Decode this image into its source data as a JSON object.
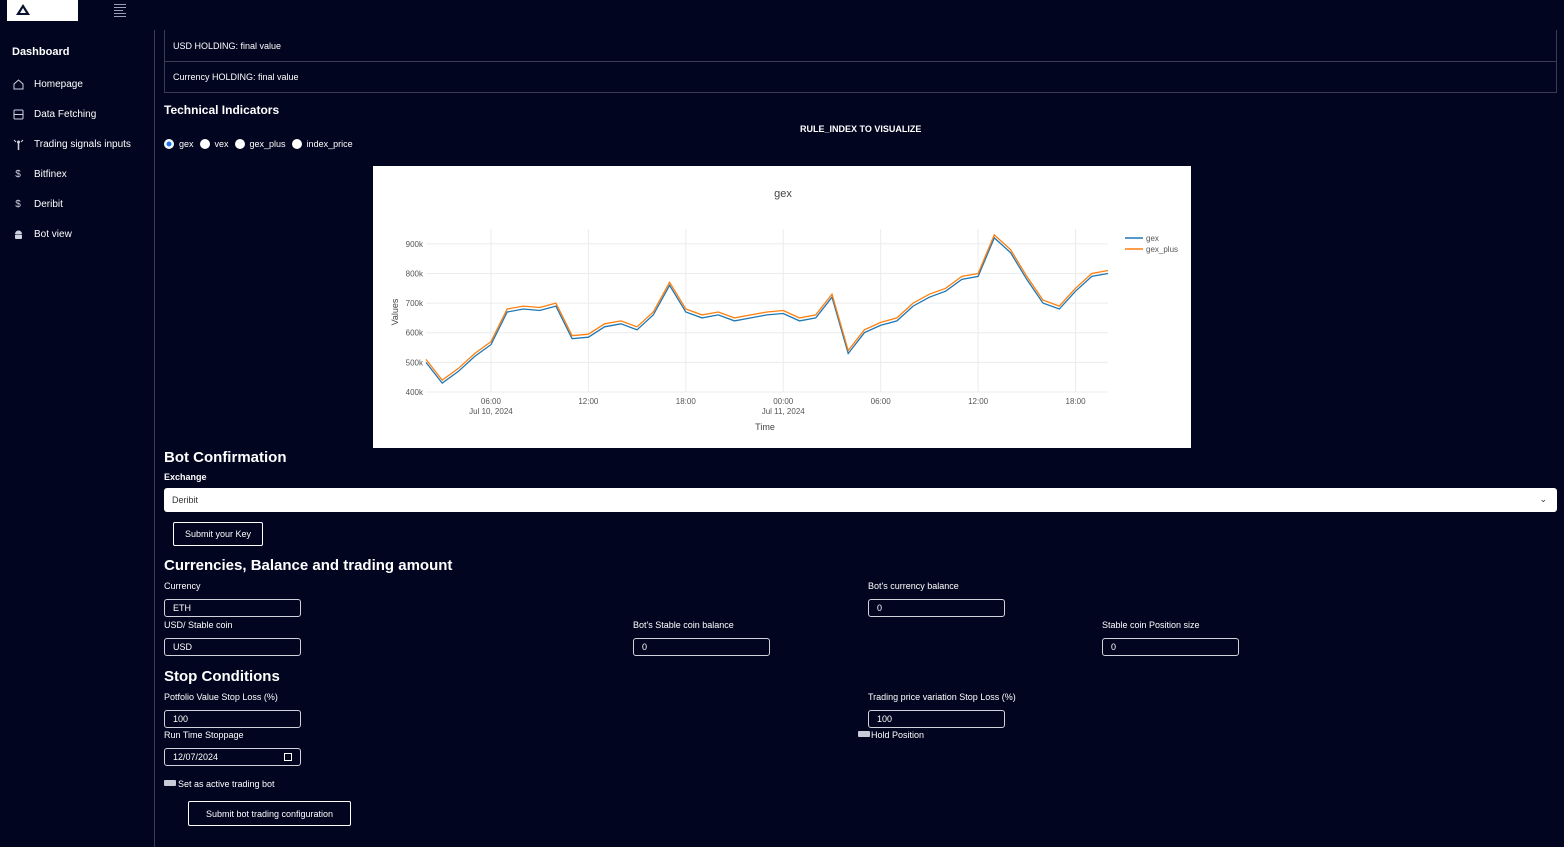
{
  "sidebar": {
    "title": "Dashboard",
    "items": [
      {
        "label": "Homepage",
        "icon": "home-icon"
      },
      {
        "label": "Data Fetching",
        "icon": "database-icon"
      },
      {
        "label": "Trading signals inputs",
        "icon": "signal-icon"
      },
      {
        "label": "Bitfinex",
        "icon": "dollar-icon"
      },
      {
        "label": "Deribit",
        "icon": "dollar-icon"
      },
      {
        "label": "Bot view",
        "icon": "android-icon"
      }
    ]
  },
  "holdings": {
    "usd": "USD HOLDING: final value",
    "currency": "Currency HOLDING: final value"
  },
  "indicators": {
    "heading": "Technical Indicators",
    "rule_label": "RULE_INDEX TO VISUALIZE",
    "options": [
      "gex",
      "vex",
      "gex_plus",
      "index_price"
    ],
    "selected": "gex"
  },
  "chart_data": {
    "type": "line",
    "title": "gex",
    "xlabel": "Time",
    "ylabel": "Values",
    "ylim": [
      400000,
      950000
    ],
    "y_ticks": [
      "400k",
      "500k",
      "600k",
      "700k",
      "800k",
      "900k"
    ],
    "x_ticks": [
      {
        "label": "06:00",
        "sub": "Jul 10, 2024"
      },
      {
        "label": "12:00",
        "sub": ""
      },
      {
        "label": "18:00",
        "sub": ""
      },
      {
        "label": "00:00",
        "sub": "Jul 11, 2024"
      },
      {
        "label": "06:00",
        "sub": ""
      },
      {
        "label": "12:00",
        "sub": ""
      },
      {
        "label": "18:00",
        "sub": ""
      }
    ],
    "x_hours": [
      0,
      1,
      2,
      3,
      4,
      5,
      6,
      7,
      8,
      9,
      10,
      11,
      12,
      13,
      14,
      15,
      16,
      17,
      18,
      19,
      20,
      21,
      22,
      23,
      24,
      25,
      26,
      27,
      28,
      29,
      30,
      31,
      32,
      33,
      34,
      35,
      36,
      37,
      38,
      39,
      40,
      41,
      42
    ],
    "series": [
      {
        "name": "gex",
        "color": "#1f77b4",
        "values": [
          500000,
          430000,
          470000,
          520000,
          560000,
          670000,
          680000,
          675000,
          690000,
          580000,
          585000,
          620000,
          630000,
          610000,
          660000,
          760000,
          670000,
          650000,
          660000,
          640000,
          650000,
          660000,
          665000,
          640000,
          650000,
          720000,
          530000,
          600000,
          625000,
          640000,
          690000,
          720000,
          740000,
          780000,
          790000,
          920000,
          870000,
          780000,
          700000,
          680000,
          740000,
          790000,
          800000
        ]
      },
      {
        "name": "gex_plus",
        "color": "#ff7f0e",
        "values": [
          510000,
          440000,
          480000,
          530000,
          570000,
          680000,
          690000,
          685000,
          700000,
          590000,
          595000,
          630000,
          640000,
          620000,
          670000,
          770000,
          680000,
          660000,
          670000,
          650000,
          660000,
          670000,
          675000,
          650000,
          660000,
          730000,
          540000,
          610000,
          635000,
          650000,
          700000,
          730000,
          750000,
          790000,
          800000,
          930000,
          880000,
          790000,
          710000,
          690000,
          750000,
          800000,
          810000
        ]
      }
    ],
    "legend": "top-right"
  },
  "bot": {
    "heading": "Bot Confirmation",
    "exchange_label": "Exchange",
    "exchange_value": "Deribit",
    "submit_key": "Submit your Key"
  },
  "balances": {
    "heading": "Currencies, Balance and trading amount",
    "currency_label": "Currency",
    "currency_value": "ETH",
    "bot_currency_balance_label": "Bot's currency balance",
    "bot_currency_balance_value": "0",
    "usd_label": "USD/ Stable coin",
    "usd_value": "USD",
    "stable_balance_label": "Bot's Stable coin balance",
    "stable_balance_value": "0",
    "position_size_label": "Stable coin Position size",
    "position_size_value": "0"
  },
  "stop": {
    "heading": "Stop Conditions",
    "portfolio_label": "Potfolio Value Stop Loss (%)",
    "portfolio_value": "100",
    "price_var_label": "Trading price variation Stop Loss (%)",
    "price_var_value": "100",
    "runtime_label": "Run Time Stoppage",
    "runtime_value": "12/07/2024",
    "hold_label": "Hold Position",
    "active_label": "Set as active trading bot",
    "submit_config": "Submit bot trading configuration"
  }
}
